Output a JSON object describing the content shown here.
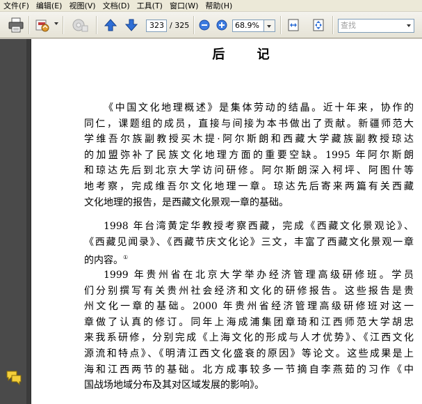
{
  "menu": {
    "items": [
      "文件(F)",
      "编辑(E)",
      "视图(V)",
      "文档(D)",
      "工具(T)",
      "窗口(W)",
      "帮助(H)"
    ]
  },
  "toolbar": {
    "current_page": "323",
    "total_pages": "/ 325",
    "zoom": "68.9%",
    "search_placeholder": "查找",
    "icons": [
      "print-icon",
      "email-icon",
      "settings-icon",
      "previous-page-icon",
      "next-page-icon",
      "zoom-out-icon",
      "zoom-in-icon",
      "fit-width-icon",
      "fit-page-icon"
    ]
  },
  "document": {
    "title": "后 记",
    "paragraphs": [
      {
        "lines": [
          "《中国文化地理概述》是集体劳动的结晶。近十年来，协作的",
          "同仁，课题组的成员，直接与间接为本书做出了贡献。新疆师范大",
          "学维吾尔族副教授买木提·阿尔斯朗和西藏大学藏族副教授琼达",
          "的加盟弥补了民族文化地理方面的重要空缺。1995 年阿尔斯朗",
          "和琼达先后到北京大学访问研修。阿尔斯朗深入柯坪、阿图什等",
          "地考察，完成维吾尔文化地理一章。琼达先后寄来两篇有关西藏",
          "文化地理的报告，是西藏文化景观一章的基础。"
        ]
      },
      {
        "lines": [
          "1998 年台湾黄定华教授考察西藏，完成《西藏文化景观论》、",
          "《西藏见闻录》、《西藏节庆文化论》三文，丰富了西藏文化景观一章",
          "的内容。"
        ],
        "footnote": "①"
      },
      {
        "lines": [
          "1999 年贵州省在北京大学举办经济管理高级研修班。学员",
          "们分别撰写有关贵州社会经济和文化的研修报告。这些报告是贵",
          "州文化一章的基础。2000 年贵州省经济管理高级研修班对这一",
          "章做了认真的修订。同年上海成浦集团章琦和江西师范大学胡忠",
          "来我系研修，分别完成《上海文化的形成与人才优势》、《江西文化",
          "源流和特点》、《明清江西文化盛衰的原因》等论文。这些成果是上",
          "海和江西两节的基础。北方成事较多一节摘自李燕茹的习作《中",
          "国战场地域分布及其对区域发展的影响》。"
        ]
      }
    ]
  },
  "colors": {
    "toolbar_bg": "#ece9d8",
    "sidebar_bg": "#4a4a4a",
    "nav_arrow": "#2f6fd6",
    "page_bg": "#ffffff"
  }
}
